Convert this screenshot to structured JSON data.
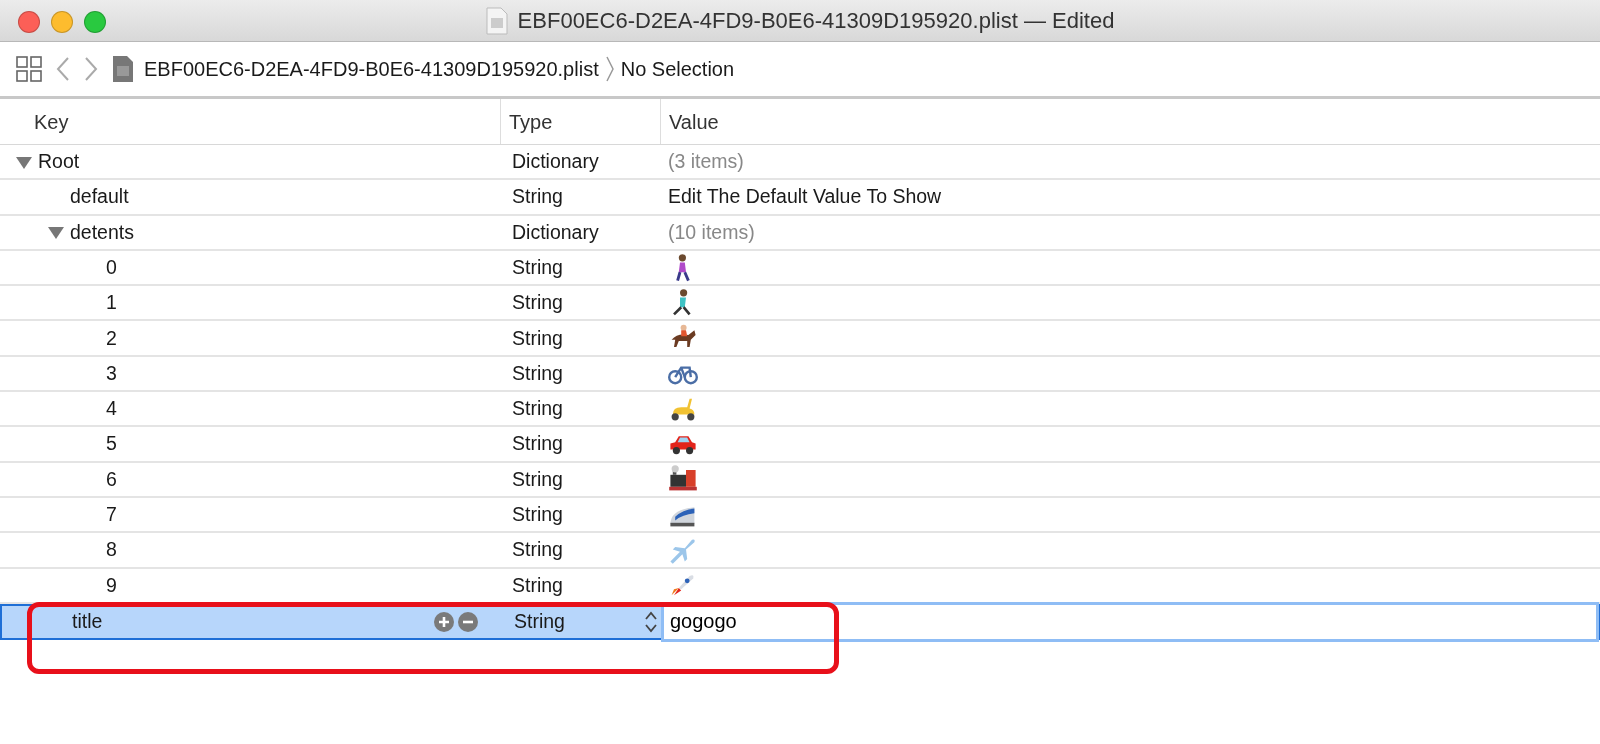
{
  "window": {
    "title": "EBF00EC6-D2EA-4FD9-B0E6-41309D195920.plist — Edited"
  },
  "breadcrumb": {
    "file": "EBF00EC6-D2EA-4FD9-B0E6-41309D195920.plist",
    "selection": "No Selection"
  },
  "table": {
    "columns": [
      "Key",
      "Type",
      "Value"
    ],
    "rows": [
      {
        "key": "Root",
        "type": "Dictionary",
        "value": "(3 items)",
        "value_muted": true,
        "expanded": true,
        "selected": false,
        "children": [
          {
            "key": "default",
            "type": "String",
            "value": "Edit The Default Value To Show",
            "selected": false
          },
          {
            "key": "detents",
            "type": "Dictionary",
            "value": "(10 items)",
            "value_muted": true,
            "expanded": true,
            "selected": false,
            "children": [
              {
                "key": "0",
                "type": "String",
                "kind": "emoji",
                "selected": false
              },
              {
                "key": "1",
                "type": "String",
                "kind": "emoji",
                "selected": false
              },
              {
                "key": "2",
                "type": "String",
                "kind": "emoji",
                "selected": false
              },
              {
                "key": "3",
                "type": "String",
                "kind": "emoji",
                "selected": false
              },
              {
                "key": "4",
                "type": "String",
                "kind": "emoji",
                "selected": false
              },
              {
                "key": "5",
                "type": "String",
                "kind": "emoji",
                "selected": false
              },
              {
                "key": "6",
                "type": "String",
                "kind": "emoji",
                "selected": false
              },
              {
                "key": "7",
                "type": "String",
                "kind": "emoji",
                "selected": false
              },
              {
                "key": "8",
                "type": "String",
                "kind": "emoji",
                "selected": false
              },
              {
                "key": "9",
                "type": "String",
                "kind": "emoji",
                "selected": false
              }
            ]
          },
          {
            "key": "title",
            "type": "String",
            "value": "gogogo",
            "selected": true,
            "editing": true
          }
        ]
      }
    ]
  }
}
